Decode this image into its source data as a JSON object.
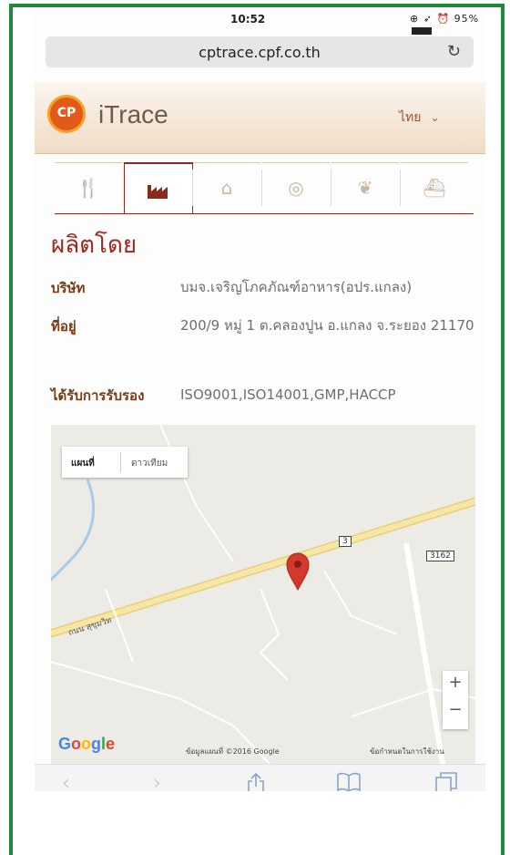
{
  "status_bar": {
    "time": "10:52",
    "battery": "95%"
  },
  "browser": {
    "url": "cptrace.cpf.co.th"
  },
  "header": {
    "logo_text": "CP",
    "brand": "iTrace",
    "language": "ไทย"
  },
  "tabs": [
    {
      "icon": "fork-knife-icon",
      "active": false
    },
    {
      "icon": "factory-icon",
      "active": true
    },
    {
      "icon": "farm-house-icon",
      "active": false
    },
    {
      "icon": "globe-icon",
      "active": false
    },
    {
      "icon": "leaf-icon",
      "active": false
    },
    {
      "icon": "ship-icon",
      "active": false
    }
  ],
  "section": {
    "title": "ผลิตโดย",
    "company_label": "บริษัท",
    "company_value": "บมจ.เจริญโภคภัณฑ์อาหาร(อปร.แกลง)",
    "address_label": "ที่อยู่",
    "address_value": "200/9 หมู่ 1 ต.คลองปูน อ.แกลง จ.ระยอง 21170",
    "cert_label": "ได้รับการรับรอง",
    "cert_value": "ISO9001,ISO14001,GMP,HACCP"
  },
  "map": {
    "type_map": "แผนที่",
    "type_satellite": "ดาวเทียม",
    "road_label": "ถนน สุขุมวิท",
    "road_number_1": "3",
    "road_number_2": "3162",
    "google": "Google",
    "copyright": "ข้อมูลแผนที่ ©2016 Google",
    "terms": "ข้อกำหนดในการใช้งาน"
  }
}
